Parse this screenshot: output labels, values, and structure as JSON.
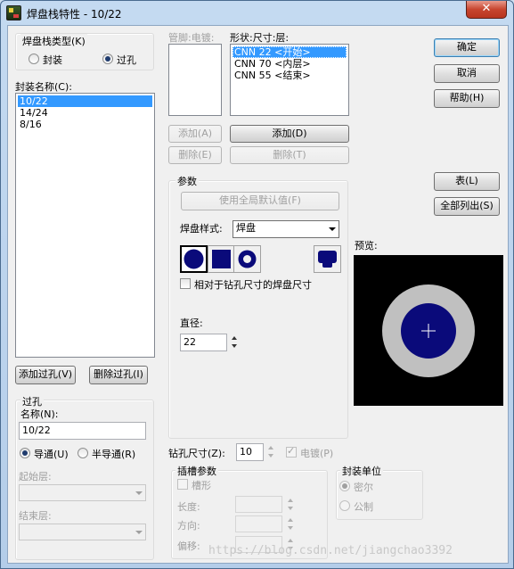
{
  "window": {
    "title": "焊盘栈特性 - 10/22",
    "close_glyph": "✕"
  },
  "stack_type": {
    "label": "焊盘栈类型(K)",
    "options": [
      "封装",
      "过孔"
    ],
    "selected": "过孔"
  },
  "package_list": {
    "label": "封装名称(C):",
    "items": [
      "10/22",
      "14/24",
      "8/16"
    ],
    "selected_index": 0
  },
  "pin_list": {
    "label": "管脚:电镀:",
    "items": []
  },
  "shape_list": {
    "label": "形状:尺寸:层:",
    "items": [
      "CNN 22 <开始>",
      "CNN 70 <内层>",
      "CNN 55 <结束>"
    ],
    "selected_index": 0
  },
  "buttons": {
    "ok": "确定",
    "cancel": "取消",
    "help": "帮助(H)",
    "add_pin": "添加(A)",
    "delete_pin": "删除(E)",
    "add_shape": "添加(D)",
    "delete_shape": "删除(T)",
    "table": "表(L)",
    "list_all": "全部列出(S)",
    "add_via": "添加过孔(V)",
    "delete_via": "删除过孔(I)",
    "use_defaults": "使用全局默认值(F)"
  },
  "params": {
    "label": "参数",
    "pad_style_label": "焊盘样式:",
    "pad_style_value": "焊盘",
    "shape_icons": [
      "round-pad-icon",
      "square-pad-icon",
      "annular-pad-icon",
      "custom-pad-icon"
    ],
    "relative_label": "相对于钻孔尺寸的焊盘尺寸",
    "diameter_label": "直径:",
    "diameter_value": "22"
  },
  "preview": {
    "label": "预览:",
    "background": "#000000",
    "ring_color": "#c0c0c0",
    "pad_color": "#0a0a7a"
  },
  "via": {
    "label": "过孔",
    "name_label": "名称(N):",
    "name_value": "10/22",
    "conduct_options": [
      "导通(U)",
      "半导通(R)"
    ],
    "conduct_selected": "导通(U)",
    "start_layer_label": "起始层:",
    "end_layer_label": "结束层:"
  },
  "drill": {
    "label": "钻孔尺寸(Z):",
    "value": "10",
    "plated_label": "电镀(P)",
    "plated_checked": true
  },
  "slot": {
    "label": "插槽参数",
    "slotted_label": "槽形",
    "length_label": "长度:",
    "direction_label": "方向:",
    "offset_label": "偏移:"
  },
  "units": {
    "label": "封装单位",
    "options": [
      "密尔",
      "公制"
    ],
    "selected": "密尔"
  },
  "watermark": "https://blog.csdn.net/jiangchao3392"
}
